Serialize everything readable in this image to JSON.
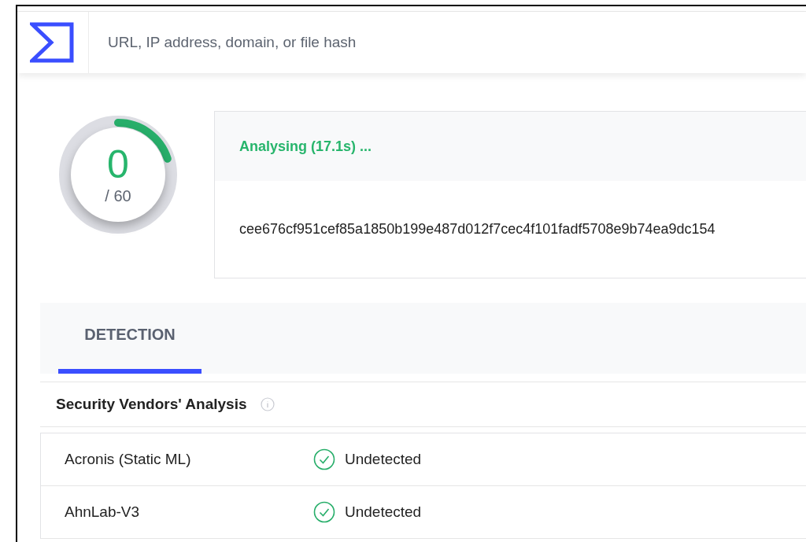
{
  "search": {
    "placeholder": "URL, IP address, domain, or file hash"
  },
  "score": {
    "detections": "0",
    "total": "/ 60",
    "level": 0.2
  },
  "analysis": {
    "status": "Analysing (17.1s) ...",
    "hash": "cee676cf951cef85a1850b199e487d012f7cec4f101fadf5708e9b74ea9dc154"
  },
  "tabs": [
    {
      "label": "DETECTION",
      "selected": true
    }
  ],
  "section": {
    "title": "Security Vendors' Analysis"
  },
  "vendors": [
    {
      "name": "Acronis (Static ML)",
      "kind": "undetected",
      "result": "Undetected"
    },
    {
      "name": "AhnLab-V3",
      "kind": "undetected",
      "result": "Undetected"
    }
  ]
}
